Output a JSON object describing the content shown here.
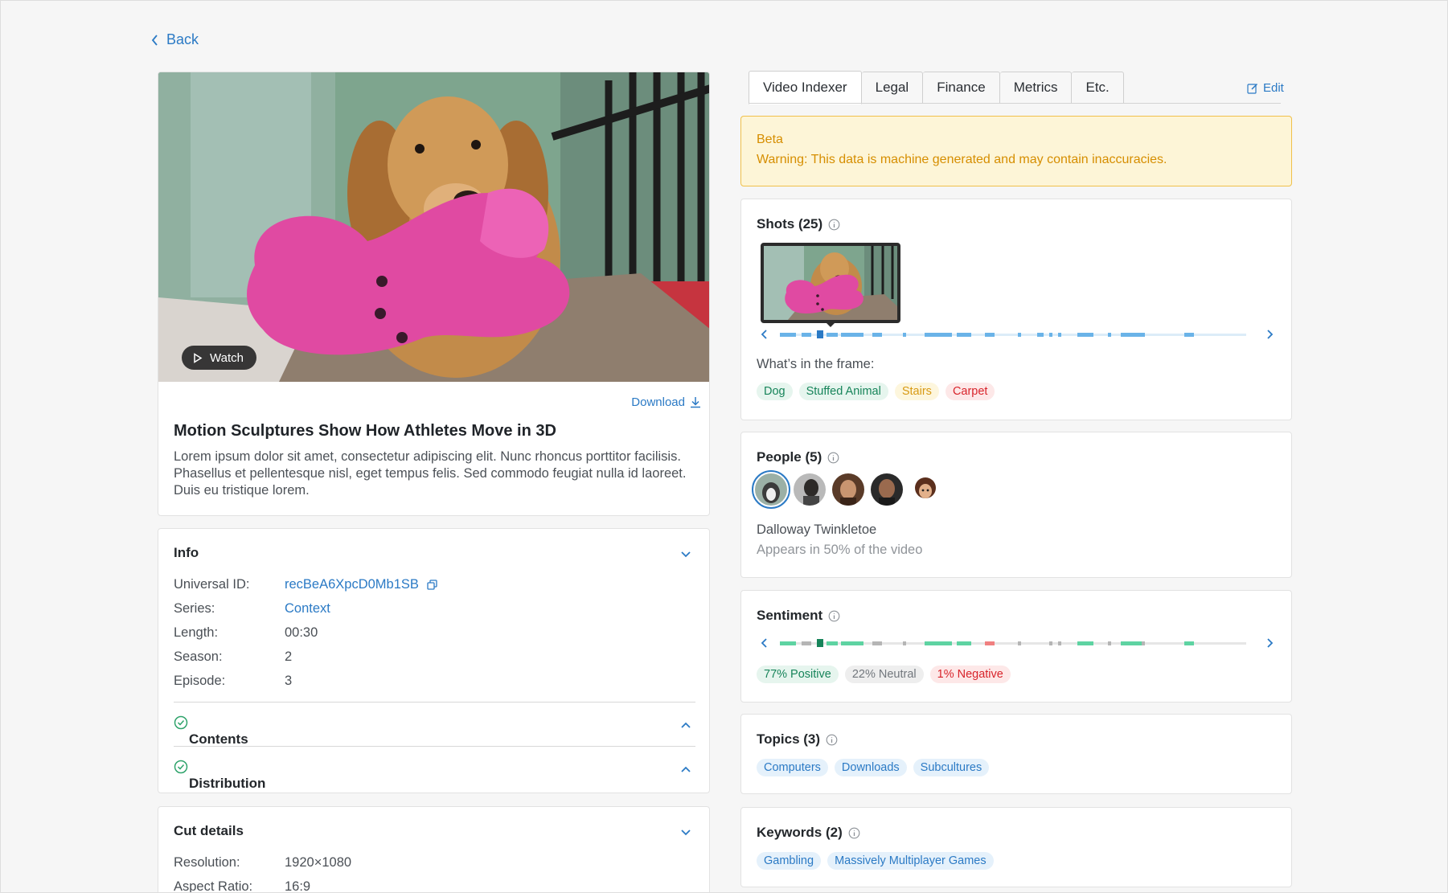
{
  "nav": {
    "back_label": "Back"
  },
  "video": {
    "watch_label": "Watch",
    "download_label": "Download",
    "title": "Motion Sculptures Show How Athletes Move in 3D",
    "description": "Lorem ipsum dolor sit amet, consectetur adipiscing elit. Nunc rhoncus porttitor facilisis. Phasellus et pellentesque nisl, eget tempus felis. Sed commodo feugiat nulla id laoreet. Duis eu tristique lorem."
  },
  "info": {
    "title": "Info",
    "rows": [
      {
        "key": "Universal ID:",
        "value": "recBeA6XpcD0Mb1SB"
      },
      {
        "key": "Series:",
        "value": "Context"
      },
      {
        "key": "Length:",
        "value": "00:30"
      },
      {
        "key": "Season:",
        "value": "2"
      },
      {
        "key": "Episode:",
        "value": "3"
      }
    ],
    "contents_label": "Contents",
    "distribution_label": "Distribution"
  },
  "cut": {
    "title": "Cut details",
    "rows": [
      {
        "key": "Resolution:",
        "value": "1920×1080"
      },
      {
        "key": "Aspect Ratio:",
        "value": "16:9"
      }
    ]
  },
  "tabs": [
    {
      "label": "Video Indexer",
      "active": true
    },
    {
      "label": "Legal"
    },
    {
      "label": "Finance"
    },
    {
      "label": "Metrics"
    },
    {
      "label": "Etc."
    }
  ],
  "edit_label": "Edit",
  "beta": {
    "title": "Beta",
    "message": "Warning: This data is machine generated and may contain inaccuracies."
  },
  "shots": {
    "title": "Shots (25)",
    "frame_label": "What’s in the frame:",
    "tags": [
      "Dog",
      "Stuffed Animal",
      "Stairs",
      "Carpet"
    ]
  },
  "people": {
    "title": "People (5)",
    "name": "Dalloway Twinkletoe",
    "appears": "Appears in 50% of the video"
  },
  "sentiment": {
    "title": "Sentiment",
    "positive": "77% Positive",
    "neutral": "22% Neutral",
    "negative": "1% Negative"
  },
  "topics": {
    "title": "Topics (3)",
    "tags": [
      "Computers",
      "Downloads",
      "Subcultures"
    ]
  },
  "keywords": {
    "title": "Keywords (2)",
    "tags": [
      "Gambling",
      "Massively Multiplayer Games"
    ]
  },
  "colors": {
    "accent": "#2b7ac5",
    "warning": "#d68e00",
    "positive": "#17845a",
    "negative": "#d8242b"
  },
  "icons": [
    "chevron-left-icon",
    "play-icon",
    "download-icon",
    "chevron-down-icon",
    "chevron-up-icon",
    "check-circle-icon",
    "copy-icon",
    "edit-icon",
    "info-icon",
    "chevron-right-icon"
  ]
}
